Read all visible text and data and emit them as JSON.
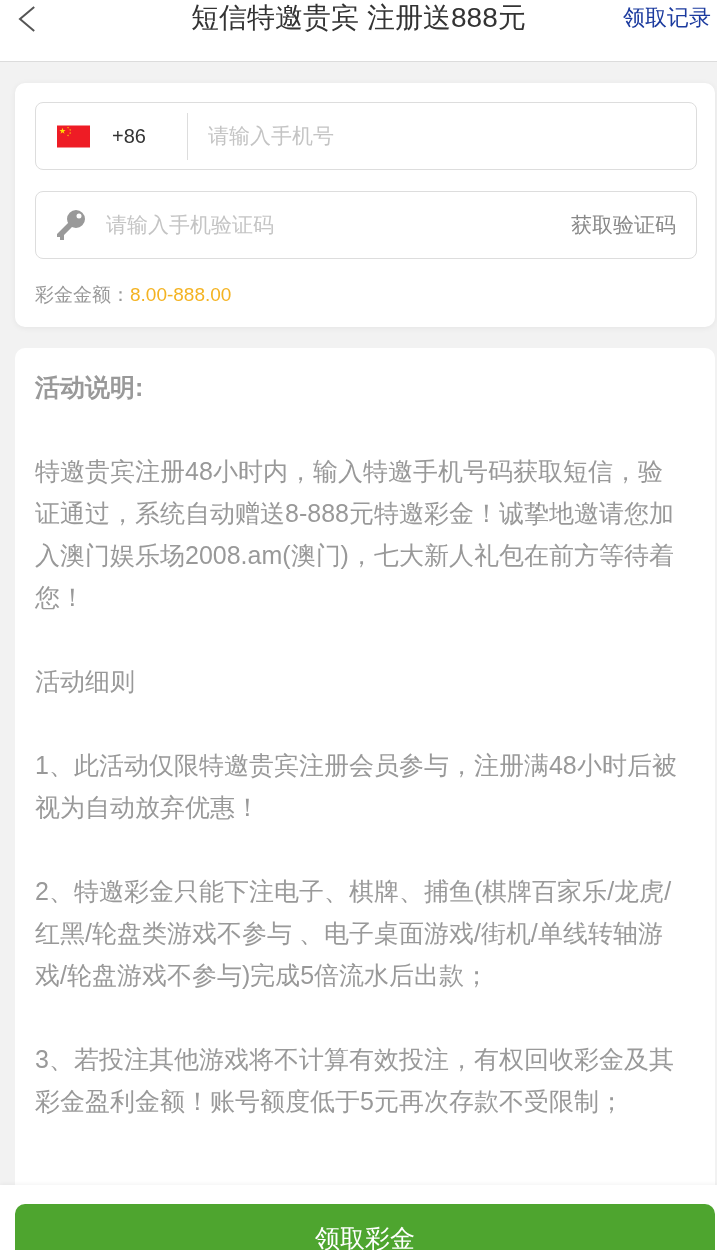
{
  "header": {
    "title": "短信特邀贵宾 注册送888元",
    "link": "领取记录"
  },
  "form": {
    "phone": {
      "country_code": "+86",
      "placeholder": "请输入手机号"
    },
    "code": {
      "placeholder": "请输入手机验证码",
      "button": "获取验证码"
    },
    "bonus": {
      "label": "彩金金额：",
      "value": "8.00-888.00"
    }
  },
  "rules": {
    "title": "活动说明:",
    "paragraphs": [
      "特邀贵宾注册48小时内，输入特邀手机号码获取短信，验证通过，系统自动赠送8-888元特邀彩金！诚挚地邀请您加入澳门娱乐场2008.am(澳门)，七大新人礼包在前方等待着您！",
      "活动细则",
      "1、此活动仅限特邀贵宾注册会员参与，注册满48小时后被视为自动放弃优惠！",
      "2、特邀彩金只能下注电子、棋牌、捕鱼(棋牌百家乐/龙虎/红黑/轮盘类游戏不参与 、电子桌面游戏/街机/单线转轴游戏/轮盘游戏不参与)完成5倍流水后出款；",
      "3、若投注其他游戏将不计算有效投注，有权回收彩金及其彩金盈利金额！账号额度低于5元再次存款不受限制；"
    ]
  },
  "footer": {
    "button": "领取彩金"
  }
}
